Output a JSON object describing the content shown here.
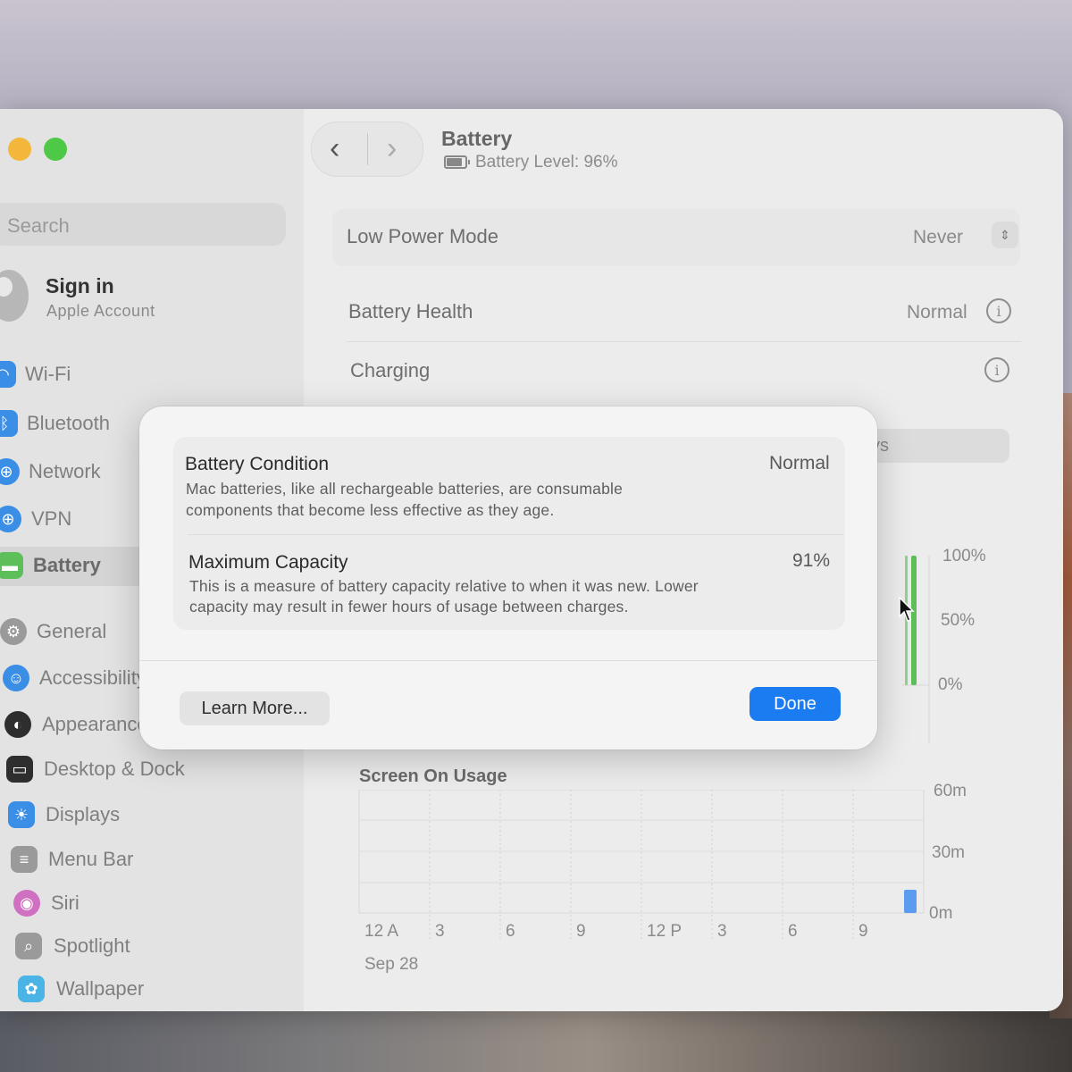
{
  "header": {
    "title": "Battery",
    "subtitle": "Battery Level: 96%"
  },
  "sidebar": {
    "search_placeholder": "Search",
    "account": {
      "name": "Sign in",
      "subtitle": "Apple Account"
    },
    "items": [
      {
        "label": "Wi-Fi",
        "icon": "wifi-icon",
        "color": "#3a8ee6"
      },
      {
        "label": "Bluetooth",
        "icon": "bluetooth-icon",
        "color": "#3a8ee6"
      },
      {
        "label": "Network",
        "icon": "globe-icon",
        "color": "#3a8ee6"
      },
      {
        "label": "VPN",
        "icon": "vpn-globe-icon",
        "color": "#3a8ee6"
      },
      {
        "label": "Battery",
        "icon": "battery-icon",
        "color": "#5cbf5a"
      },
      {
        "label": "General",
        "icon": "gear-icon",
        "color": "#9a9a9a"
      },
      {
        "label": "Accessibility",
        "icon": "accessibility-icon",
        "color": "#3a8ee6"
      },
      {
        "label": "Appearance",
        "icon": "appearance-icon",
        "color": "#2e2e2e"
      },
      {
        "label": "Desktop & Dock",
        "icon": "dock-icon",
        "color": "#2e2e2e"
      },
      {
        "label": "Displays",
        "icon": "sun-icon",
        "color": "#3a8ee6"
      },
      {
        "label": "Menu Bar",
        "icon": "menubar-icon",
        "color": "#9a9a9a"
      },
      {
        "label": "Siri",
        "icon": "siri-icon",
        "color": "#d070c0"
      },
      {
        "label": "Spotlight",
        "icon": "magnifier-icon",
        "color": "#9a9a9a"
      },
      {
        "label": "Wallpaper",
        "icon": "flower-icon",
        "color": "#4ab4e6"
      }
    ]
  },
  "settings": {
    "low_power_label": "Low Power Mode",
    "low_power_value": "Never",
    "health_label": "Battery Health",
    "health_value": "Normal",
    "charging_label": "Charging",
    "tab_partial": "ys"
  },
  "level_chart": {
    "y_ticks": [
      "100%",
      "50%",
      "0%"
    ]
  },
  "usage_chart": {
    "title": "Screen On Usage",
    "y_ticks": [
      "60m",
      "30m",
      "0m"
    ],
    "x_ticks": [
      "12 A",
      "3",
      "6",
      "9",
      "12 P",
      "3",
      "6",
      "9"
    ],
    "date_label": "Sep 28"
  },
  "dialog": {
    "condition_label": "Battery Condition",
    "condition_value": "Normal",
    "condition_desc_line1": "Mac batteries, like all rechargeable batteries, are consumable",
    "condition_desc_line2": "components that become less effective as they age.",
    "capacity_label": "Maximum Capacity",
    "capacity_value": "91%",
    "capacity_desc_line1": "This is a measure of battery capacity relative to when it was new. Lower",
    "capacity_desc_line2": "capacity may result in fewer hours of usage between charges.",
    "learn_more_label": "Learn More...",
    "done_label": "Done"
  },
  "colors": {
    "accent": "#1b7cf2",
    "battery_green": "#5cbf5a"
  }
}
